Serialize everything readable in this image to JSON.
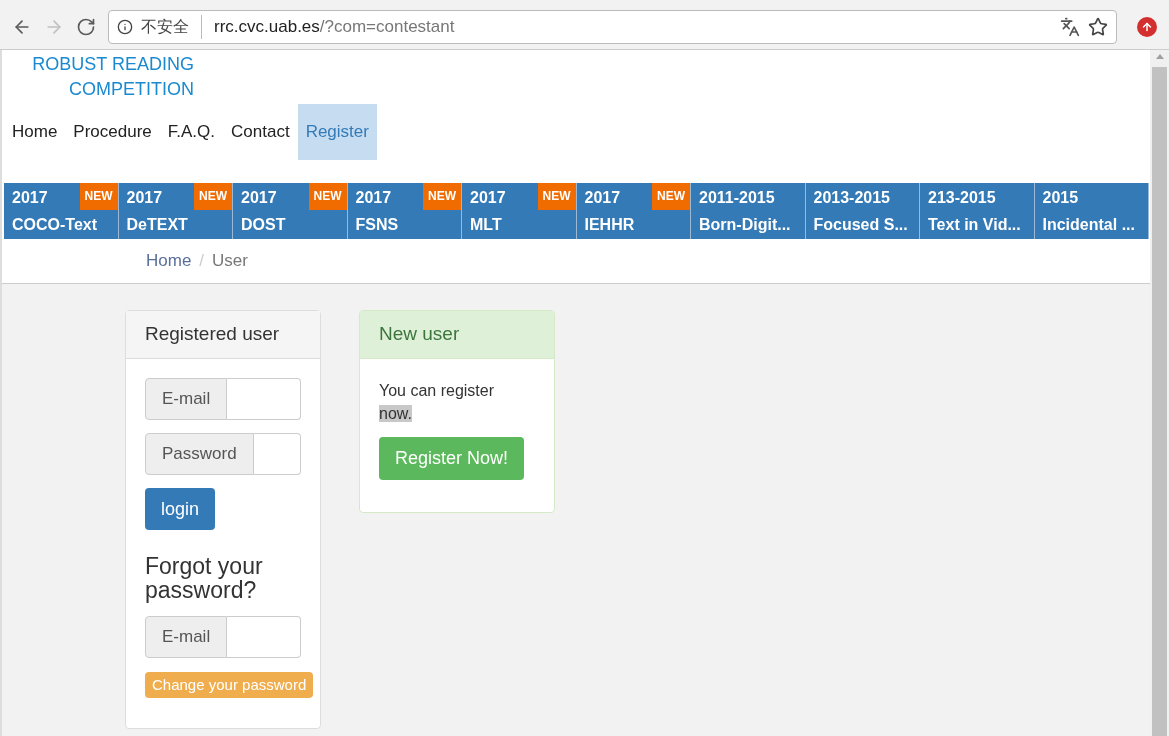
{
  "browser": {
    "security_label": "不安全",
    "url_host": "rrc.cvc.uab.es",
    "url_path": "/?com=contestant"
  },
  "logo": [
    "ROBUST READING",
    "COMPETITION"
  ],
  "nav": [
    {
      "label": "Home",
      "selected": false
    },
    {
      "label": "Procedure",
      "selected": false
    },
    {
      "label": "F.A.Q.",
      "selected": false
    },
    {
      "label": "Contact",
      "selected": false
    },
    {
      "label": "Register",
      "selected": true
    }
  ],
  "challenges": [
    {
      "year": "2017",
      "name": "COCO-Text",
      "badge": "NEW"
    },
    {
      "year": "2017",
      "name": "DeTEXT",
      "badge": "NEW"
    },
    {
      "year": "2017",
      "name": "DOST",
      "badge": "NEW"
    },
    {
      "year": "2017",
      "name": "FSNS",
      "badge": "NEW"
    },
    {
      "year": "2017",
      "name": "MLT",
      "badge": "NEW"
    },
    {
      "year": "2017",
      "name": "IEHHR",
      "badge": "NEW"
    },
    {
      "year": "2011-2015",
      "name": "Born-Digit..."
    },
    {
      "year": "2013-2015",
      "name": "Focused S..."
    },
    {
      "year": "213-2015",
      "name": "Text in Vid..."
    },
    {
      "year": "2015",
      "name": "Incidental ..."
    }
  ],
  "breadcrumb": [
    "Home",
    "User"
  ],
  "breadcrumb_separator": "/",
  "registered": {
    "title": "Registered user",
    "fields": [
      {
        "label": "E-mail"
      },
      {
        "label": "Password"
      }
    ],
    "login": "login",
    "forgot_title": "Forgot your password?",
    "reset_field": {
      "label": "E-mail"
    },
    "change_button": "Change your password"
  },
  "new_user": {
    "title": "New user",
    "text": "You can register",
    "text_selected": "now.",
    "button": "Register Now!"
  }
}
